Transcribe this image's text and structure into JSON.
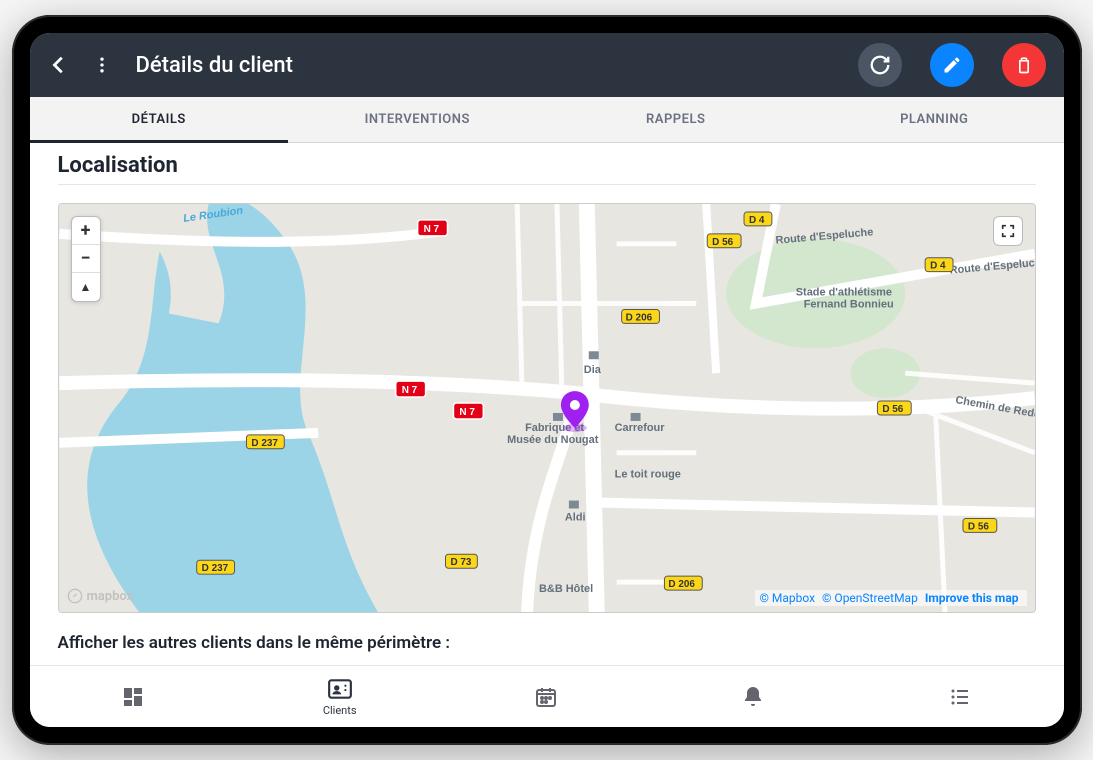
{
  "header": {
    "title": "Détails du client"
  },
  "tabs": {
    "details": "DÉTAILS",
    "interventions": "INTERVENTIONS",
    "rappels": "RAPPELS",
    "planning": "PLANNING"
  },
  "section": {
    "localisation_title": "Localisation",
    "perimeter_label": "Afficher les autres clients dans le même périmètre :"
  },
  "map": {
    "controls": {
      "zoom_in": "+",
      "zoom_out": "−",
      "compass": "▲"
    },
    "logo_text": "mapbox",
    "attribution_mapbox": "© Mapbox",
    "attribution_osm": "© OpenStreetMap",
    "attribution_improve": "Improve this map",
    "pois": {
      "dia": "Dia",
      "fabrique": "Fabrique &\nMusée du Nougat",
      "carrefour": "Carrefour",
      "letoitrouge": "Le toit rouge",
      "aldi": "Aldi",
      "bbhotel": "B&B Hôtel",
      "stade": "Stade d'athlétisme\nFernand Bonnieu"
    },
    "roads": {
      "route_espeluche_1": "Route d'Espeluche",
      "route_espeluche_2": "Route d'Espeluche",
      "le_roubion": "Le Roubion",
      "chemin_redo": "Chemin de Redo"
    },
    "shields": {
      "n7": "N 7",
      "d237": "D 237",
      "d73": "D 73",
      "d4": "D 4",
      "d56": "D 56",
      "d206": "D 206"
    }
  },
  "bottom_nav": {
    "clients": "Clients"
  }
}
